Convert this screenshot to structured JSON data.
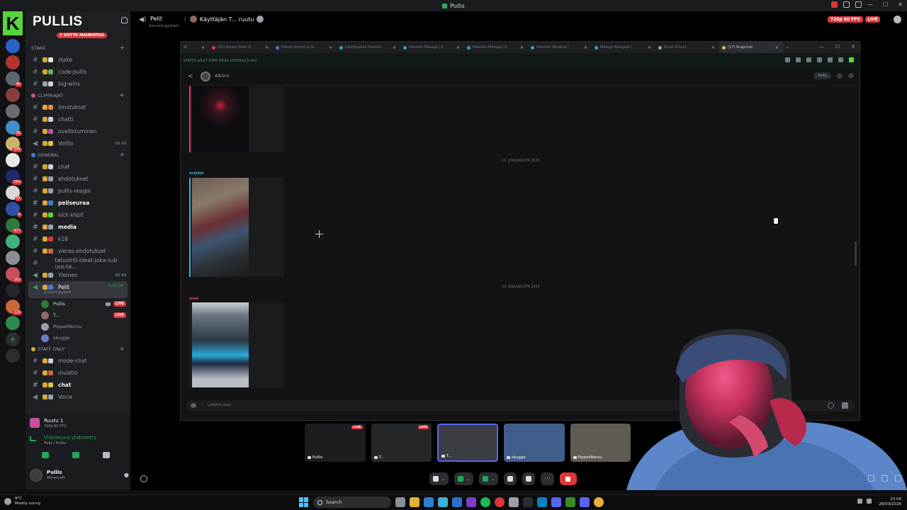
{
  "window": {
    "title": "Pullis"
  },
  "server": {
    "name": "PULLIS",
    "mention_pill": "3 UUTTA MAININTAA",
    "logo_letter": "K"
  },
  "rail_servers": [
    {
      "color": "#2a62c9",
      "badge": ""
    },
    {
      "color": "#b5342e",
      "badge": ""
    },
    {
      "color": "#5e6670",
      "badge": "46"
    },
    {
      "color": "#8a3c3c",
      "badge": ""
    },
    {
      "color": "#6b6b70",
      "badge": ""
    },
    {
      "color": "#3f8fc7",
      "badge": "36"
    },
    {
      "color": "#c9b46b",
      "badge": "396"
    },
    {
      "color": "#e8e8e8",
      "badge": ""
    },
    {
      "color": "#1d2a6e",
      "badge": "264"
    },
    {
      "color": "#d8d8d8",
      "badge": "91"
    },
    {
      "color": "#2f4fa8",
      "badge": "6"
    },
    {
      "color": "#2e7a3a",
      "badge": "477"
    },
    {
      "color": "#3fb27a",
      "badge": ""
    },
    {
      "color": "#8a8f96",
      "badge": ""
    },
    {
      "color": "#c74f5e",
      "badge": "163"
    },
    {
      "color": "#25272b",
      "badge": ""
    },
    {
      "color": "#c9683a",
      "badge": "116"
    },
    {
      "color": "#2d8a4a",
      "badge": ""
    }
  ],
  "categories": {
    "stake": "Stake",
    "clippaajat": "CLIPPAAJAT",
    "general": "GENERAL",
    "staff": "STAFF ONLY"
  },
  "stake_channels": [
    {
      "name": "stake",
      "c1": "#d7a93a",
      "c2": "#e9e2d0"
    },
    {
      "name": "code-pullis",
      "c1": "#d7a93a",
      "c2": "#5bb85b"
    },
    {
      "name": "big-wins",
      "c1": "#9aa1a9",
      "c2": "#cfd3d8"
    }
  ],
  "clip_channels": [
    {
      "name": "ilmotukset",
      "c1": "#d7a93a",
      "c2": "#e08a3c",
      "right": ""
    },
    {
      "name": "chatti",
      "c1": "#d7a93a",
      "c2": "#cfd3d8",
      "right": ""
    },
    {
      "name": "osallistuminen",
      "c1": "#d7a93a",
      "c2": "#c74f9e",
      "right": ""
    },
    {
      "name": "Voitto",
      "c1": "#d7a93a",
      "c2": "#e0c34a",
      "right": "00  99"
    }
  ],
  "general_channels": [
    {
      "name": "chat",
      "bold": false,
      "c1": "#d7a93a",
      "c2": "#cfd3d8",
      "right": ""
    },
    {
      "name": "ehdotukset",
      "bold": false,
      "c1": "#d7a93a",
      "c2": "#9aa1a9",
      "right": ""
    },
    {
      "name": "pullis-reagoi",
      "bold": false,
      "c1": "#d7a93a",
      "c2": "#9aa1a9",
      "right": ""
    },
    {
      "name": "peliseuraa",
      "bold": true,
      "c1": "#d7a93a",
      "c2": "#4a7bd0",
      "right": ""
    },
    {
      "name": "kick-klipit",
      "bold": false,
      "c1": "#d7a93a",
      "c2": "#56d63c",
      "right": ""
    },
    {
      "name": "media",
      "bold": true,
      "c1": "#d7a93a",
      "c2": "#9aa1a9",
      "right": ""
    },
    {
      "name": "k18",
      "bold": false,
      "c1": "#d7a93a",
      "c2": "#da373c",
      "right": ""
    },
    {
      "name": "vieras-ehdotukset",
      "bold": false,
      "c1": "#d7a93a",
      "c2": "#c9683a",
      "right": ""
    },
    {
      "name": "tatuointi-ideat-joka-sub-uus-ta...",
      "bold": false,
      "c1": "",
      "c2": "",
      "right": ""
    },
    {
      "name": "Yleinen",
      "bold": false,
      "c1": "#d7a93a",
      "c2": "#9aa1a9",
      "right": "00  99"
    }
  ],
  "active_channel": {
    "name": "Pelit",
    "sub": "discord.gg/kark",
    "time": "5:55:30"
  },
  "voice_users": [
    {
      "name": "Pullis",
      "live": "LIVE",
      "cam": true,
      "av": "#2e7a3a",
      "dim": false
    },
    {
      "name": "T...",
      "live": "LIVE",
      "cam": false,
      "av": "#8a6a62",
      "dim": false
    },
    {
      "name": "PippeliNorsu",
      "live": "",
      "cam": false,
      "av": "#9aa1a9",
      "dim": true
    },
    {
      "name": "skugge",
      "live": "",
      "cam": false,
      "av": "#6b7cc7",
      "dim": true
    }
  ],
  "staff_channels": [
    {
      "name": "mode-chat",
      "bold": false,
      "c1": "#d7a93a",
      "c2": "#cfd3d8"
    },
    {
      "name": "muistio",
      "bold": false,
      "c1": "#d7a93a",
      "c2": "#c9683a"
    },
    {
      "name": "chat",
      "bold": true,
      "c1": "#d7a93a",
      "c2": "#e0c34a"
    },
    {
      "name": "Voice",
      "bold": false,
      "c1": "#d7a93a",
      "c2": "#9aa1a9"
    }
  ],
  "guild_card": {
    "name": "Ruutu 1",
    "sub": "720p 60 FPS"
  },
  "voice_status": {
    "title": "Videokuva yhdistetty",
    "sub": "Pelit / Pullis"
  },
  "user": {
    "name": "Pullis",
    "status": "Minecraft"
  },
  "call_header": {
    "channel": "Pelit",
    "invite": "discord.gg/kark",
    "separator": "/",
    "viewer": "Käyttäjän T... ruutu",
    "quality": "720p 60 FPS",
    "live": "LIVE"
  },
  "browser": {
    "tabs": [
      {
        "label": "et",
        "color": ""
      },
      {
        "label": "(41) Alvaro Soler ft.",
        "color": "#da373c"
      },
      {
        "label": "Halvat lennot ja lo...",
        "color": "#4a7bd0"
      },
      {
        "label": "Lähtöpaikka Helsinki",
        "color": "#2aa7b8"
      },
      {
        "label": "Helsinki–Málaga | A",
        "color": "#2aa7b8"
      },
      {
        "label": "Helsinki–Málaga | A",
        "color": "#2aa7b8"
      },
      {
        "label": "Helsinki–Alicante |",
        "color": "#2aa7b8"
      },
      {
        "label": "Málaga–Bangkok |",
        "color": "#2aa7b8"
      },
      {
        "label": "Kuvat iCloud",
        "color": "#9aa1a9"
      },
      {
        "label": "(17) Snapchat",
        "color": "#e0c34a"
      }
    ],
    "url": "df4f50-a5e7-5f86-869a-d95f6a22c4f2",
    "chat_name": "Albiino",
    "header_btn": "Soita",
    "date1": "11. JOULUKUUTA 2025",
    "date2": "23. JOULUKUUTA 2025",
    "sender_albiino": "ALBIINO",
    "sender_mina": "MINÄ",
    "composer_placeholder": "Lähetä chat"
  },
  "stream_tiles": [
    {
      "label": "Pullis",
      "live": "LIVE",
      "sel": false,
      "bg": "#1b1d20"
    },
    {
      "label": "T...",
      "live": "LIVE",
      "sel": false,
      "bg": "#24282b"
    },
    {
      "label": "T...",
      "live": "",
      "sel": true,
      "bg": "#3a3d41"
    },
    {
      "label": "skugge",
      "live": "",
      "sel": false,
      "bg": "#3f5f8a"
    },
    {
      "label": "PippeliNorsu",
      "live": "",
      "sel": false,
      "bg": "#5f5a52"
    }
  ],
  "taskbar": {
    "weather_temp": "9°C",
    "weather_text": "Mostly sunny",
    "search": "Search",
    "time": "23.09",
    "date": "28/03/2026"
  }
}
